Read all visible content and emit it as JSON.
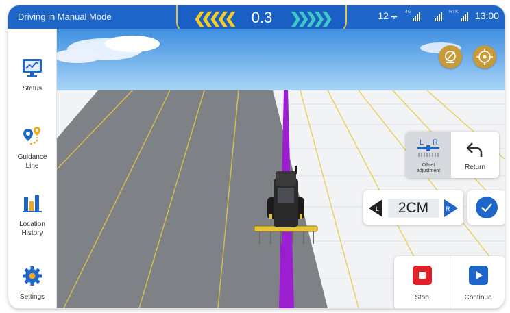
{
  "status_bar": {
    "mode": "Driving in Manual Mode",
    "offset_value": "0.3",
    "satellite_count": "12",
    "signal_labels": [
      "4G",
      "",
      "RTK"
    ],
    "time": "13:00"
  },
  "sidebar": {
    "items": [
      {
        "label": "Status",
        "icon": "monitor-chart-icon"
      },
      {
        "label": "Guidance\nLine",
        "icon": "route-pin-icon"
      },
      {
        "label": "Location\nHistory",
        "icon": "bar-chart-icon"
      },
      {
        "label": "Settings",
        "icon": "gear-icon"
      }
    ]
  },
  "controls": {
    "offset_label": "Offset\nadjustment",
    "offset_icon_left": "L",
    "offset_icon_right": "R",
    "return_label": "Return",
    "step_value": "2CM",
    "step_left": "L",
    "step_right": "R",
    "stop_label": "Stop",
    "continue_label": "Continue"
  },
  "colors": {
    "primary": "#1f66c9",
    "accent_yellow": "#f3cc2a",
    "guidance_line": "#9b1fd0",
    "stop_red": "#e0202a"
  }
}
